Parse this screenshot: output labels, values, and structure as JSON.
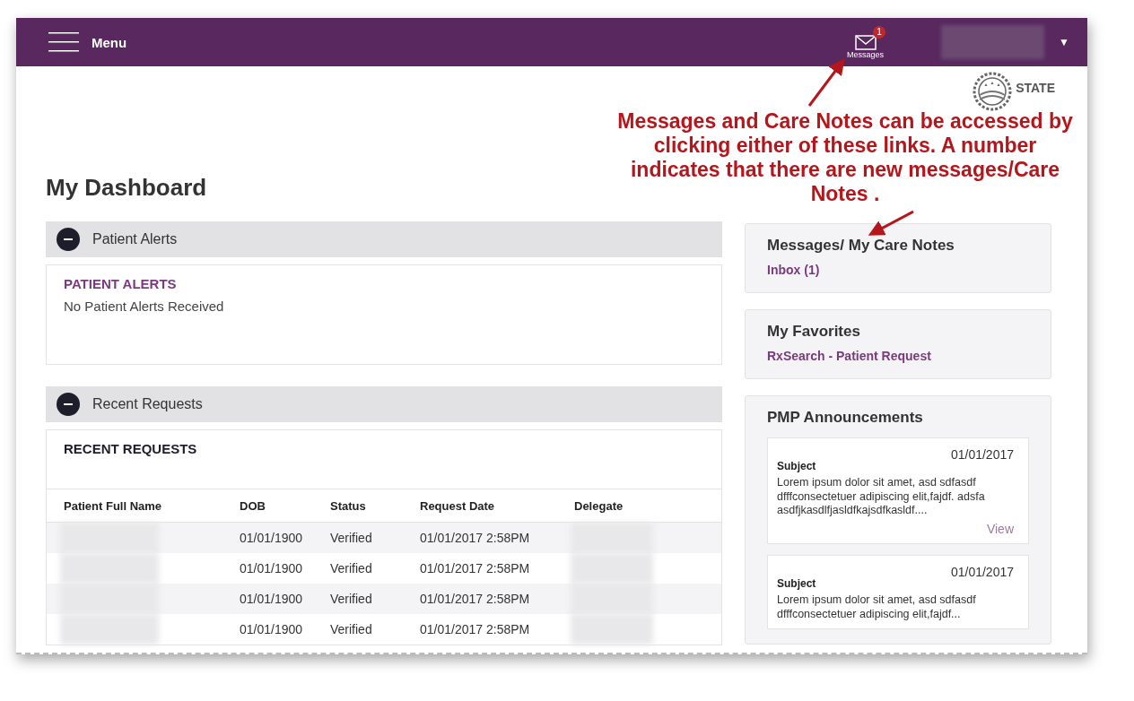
{
  "header": {
    "menu_label": "Menu",
    "messages": {
      "label": "Messages",
      "badge": "1"
    },
    "user_menu_caret": "▼"
  },
  "logo": {
    "text": "STATE"
  },
  "page_title": "My Dashboard",
  "annotation": {
    "text": "Messages and Care Notes can be accessed by clicking either of these links. A number indicates that there are new messages/Care Notes ."
  },
  "sections": [
    {
      "title": "Patient Alerts",
      "expanded": true,
      "heading": "PATIENT ALERTS",
      "kind": "alerts",
      "message": "No Patient Alerts Received"
    },
    {
      "title": "Recent Requests",
      "expanded": true,
      "heading": "RECENT REQUESTS",
      "kind": "table",
      "columns": [
        "Patient Full Name",
        "DOB",
        "Status",
        "Request Date",
        "Delegate"
      ],
      "rows": [
        {
          "dob": "01/01/1900",
          "status": "Verified",
          "request_date": "01/01/2017 2:58PM"
        },
        {
          "dob": "01/01/1900",
          "status": "Verified",
          "request_date": "01/01/2017 2:58PM"
        },
        {
          "dob": "01/01/1900",
          "status": "Verified",
          "request_date": "01/01/2017 2:58PM"
        },
        {
          "dob": "01/01/1900",
          "status": "Verified",
          "request_date": "01/01/2017 2:58PM"
        }
      ]
    }
  ],
  "messages_card": {
    "title": "Messages/ My Care Notes",
    "link": "Inbox (1)"
  },
  "favorites_card": {
    "title": "My Favorites",
    "link": "RxSearch - Patient Request"
  },
  "announcements": {
    "title": "PMP Announcements",
    "items": [
      {
        "date": "01/01/2017",
        "subject": "Subject",
        "body": "Lorem ipsum dolor sit amet, asd sdfasdf dfffconsectetuer adipiscing elit,fajdf. adsfa asdfjkasdlfjasldfkajsdfkasldf....",
        "link": "View"
      },
      {
        "date": "01/01/2017",
        "subject": "Subject",
        "body": "Lorem ipsum dolor sit amet, asd sdfasdf dfffconsectetuer adipiscing elit,fajdf..."
      }
    ]
  }
}
